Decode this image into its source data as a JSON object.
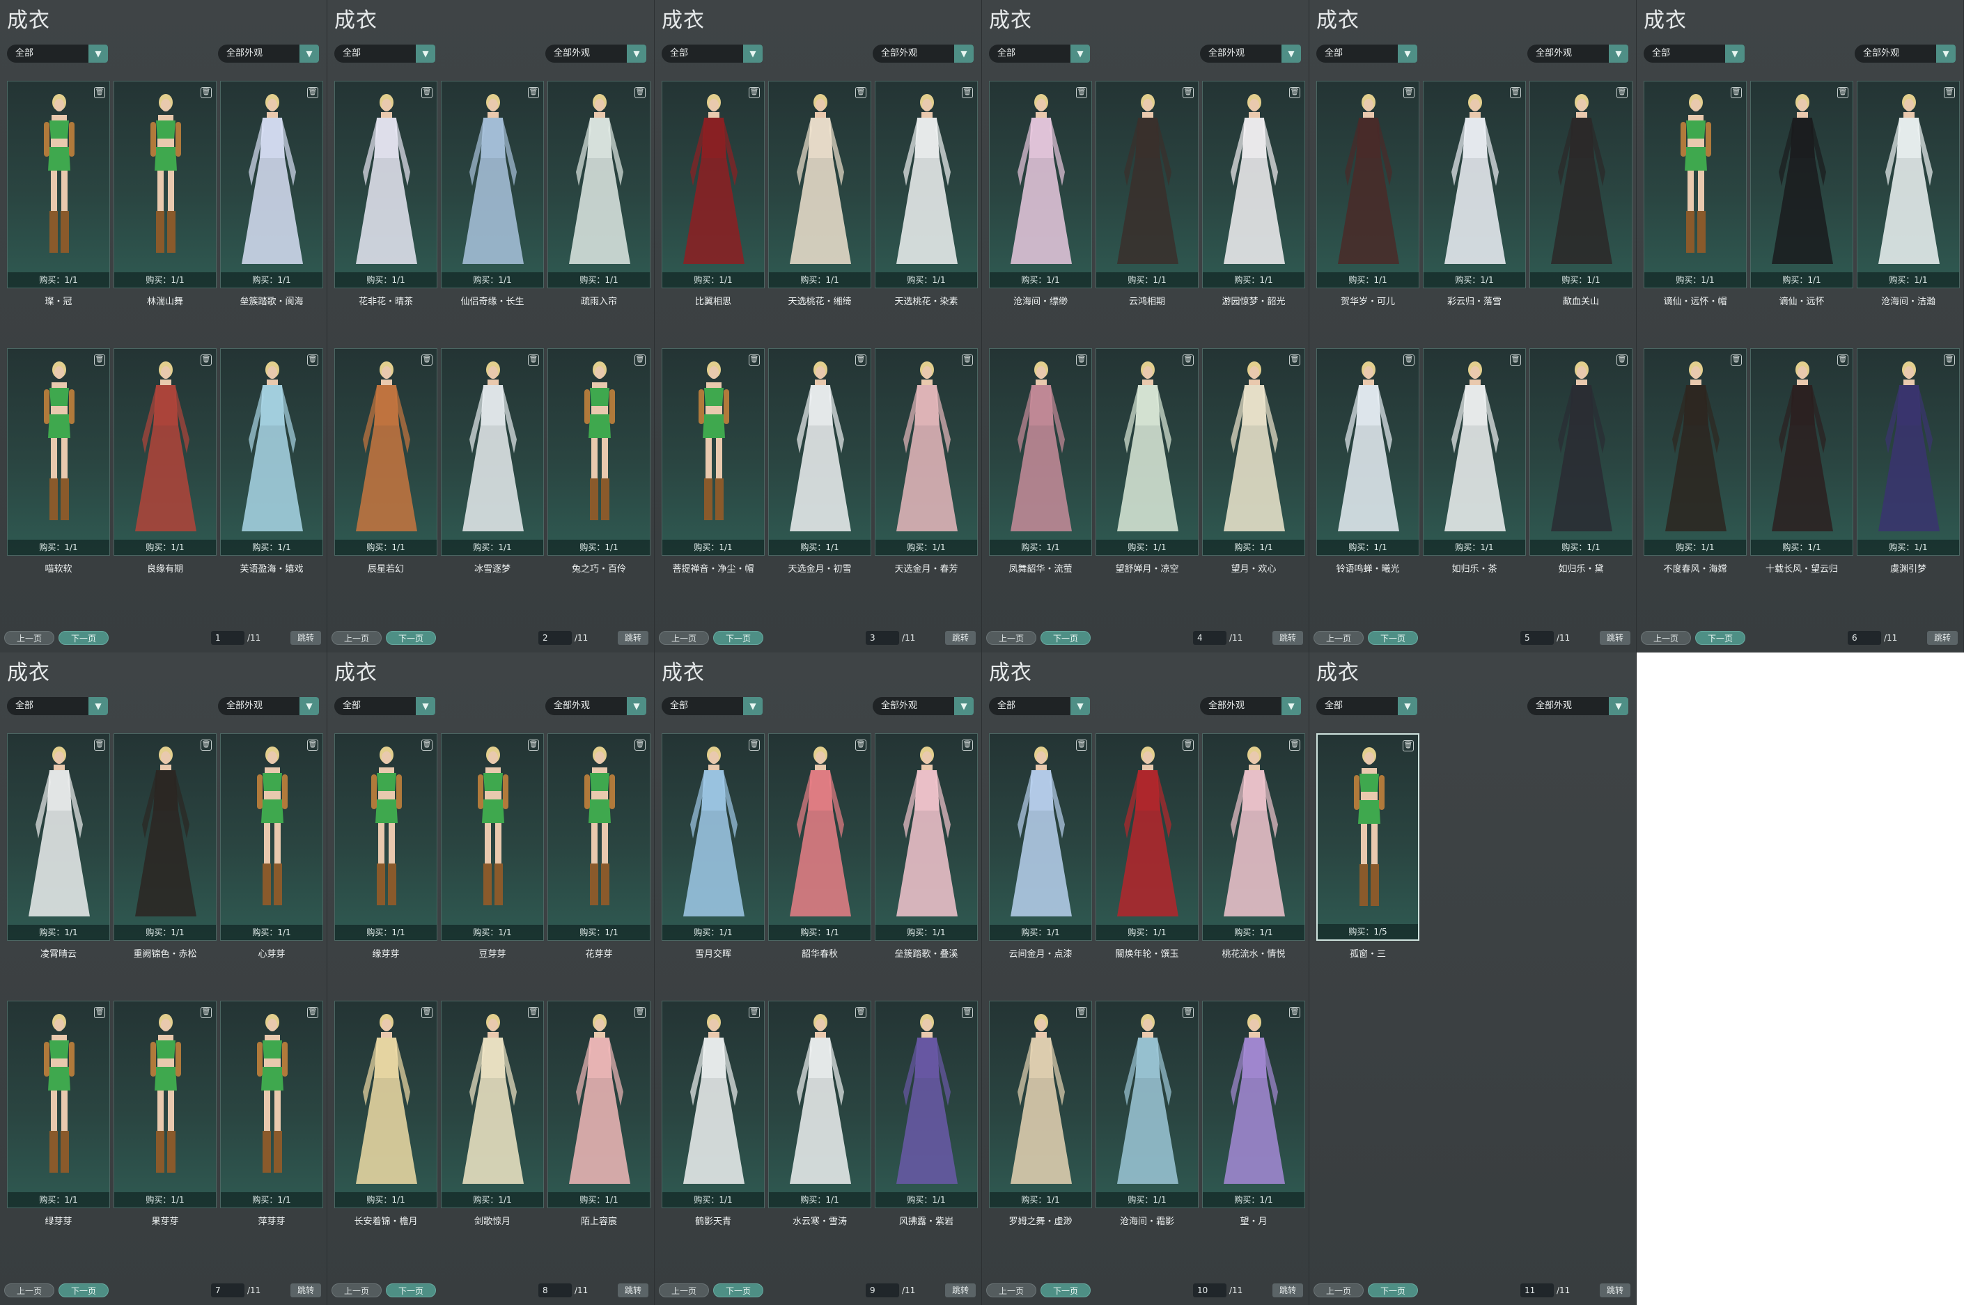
{
  "common": {
    "title": "成衣",
    "filter1": "全部",
    "filter2": "全部外观",
    "prev": "上一页",
    "next": "下一页",
    "total": "/11",
    "jump": "跳转"
  },
  "panels": [
    {
      "page": "1",
      "items": [
        {
          "buy": "购买：1/1",
          "name": "璨・冠"
        },
        {
          "buy": "购买：1/1",
          "name": "林湍山舞"
        },
        {
          "buy": "购买：1/1",
          "name": "垒簇踏歌・阆海"
        },
        {
          "buy": "购买：1/1",
          "name": "喵软软"
        },
        {
          "buy": "购买：1/1",
          "name": "良缘有期"
        },
        {
          "buy": "购买：1/1",
          "name": "芙语盈海・嬉戏"
        }
      ]
    },
    {
      "page": "2",
      "items": [
        {
          "buy": "购买：1/1",
          "name": "花非花・晴茶"
        },
        {
          "buy": "购买：1/1",
          "name": "仙侣奇缘・长生"
        },
        {
          "buy": "购买：1/1",
          "name": "疏雨入帘"
        },
        {
          "buy": "购买：1/1",
          "name": "辰星若幻"
        },
        {
          "buy": "购买：1/1",
          "name": "冰雪逐梦"
        },
        {
          "buy": "购买：1/1",
          "name": "兔之巧・百伶"
        }
      ]
    },
    {
      "page": "3",
      "items": [
        {
          "buy": "购买：1/1",
          "name": "比翼相思"
        },
        {
          "buy": "购买：1/1",
          "name": "天选桃花・缃绮"
        },
        {
          "buy": "购买：1/1",
          "name": "天选桃花・染素"
        },
        {
          "buy": "购买：1/1",
          "name": "菩提禅音・净尘・帽"
        },
        {
          "buy": "购买：1/1",
          "name": "天选金月・初雪"
        },
        {
          "buy": "购买：1/1",
          "name": "天选金月・春芳"
        }
      ]
    },
    {
      "page": "4",
      "items": [
        {
          "buy": "购买：1/1",
          "name": "沧海间・缥缈"
        },
        {
          "buy": "购买：1/1",
          "name": "云鸿相期"
        },
        {
          "buy": "购买：1/1",
          "name": "游园惊梦・韶光"
        },
        {
          "buy": "购买：1/1",
          "name": "凤舞韶华・流萤"
        },
        {
          "buy": "购买：1/1",
          "name": "望舒婵月・凉空"
        },
        {
          "buy": "购买：1/1",
          "name": "望月・欢心"
        }
      ]
    },
    {
      "page": "5",
      "items": [
        {
          "buy": "购买：1/1",
          "name": "贺华岁・可儿"
        },
        {
          "buy": "购买：1/1",
          "name": "彩云归・落雪"
        },
        {
          "buy": "购买：1/1",
          "name": "歃血关山"
        },
        {
          "buy": "购买：1/1",
          "name": "铃语鸣蝉・曦光"
        },
        {
          "buy": "购买：1/1",
          "name": "如归乐・茶"
        },
        {
          "buy": "购买：1/1",
          "name": "如归乐・黛"
        }
      ]
    },
    {
      "page": "6",
      "items": [
        {
          "buy": "购买：1/1",
          "name": "谪仙・远怀・帽"
        },
        {
          "buy": "购买：1/1",
          "name": "谪仙・远怀"
        },
        {
          "buy": "购买：1/1",
          "name": "沧海间・洁瀚"
        },
        {
          "buy": "购买：1/1",
          "name": "不度春风・海嫦"
        },
        {
          "buy": "购买：1/1",
          "name": "十载长风・望云归"
        },
        {
          "buy": "购买：1/1",
          "name": "虞渊引梦"
        }
      ]
    },
    {
      "page": "7",
      "items": [
        {
          "buy": "购买：1/1",
          "name": "凌霄晴云"
        },
        {
          "buy": "购买：1/1",
          "name": "重阙锦色・赤松"
        },
        {
          "buy": "购买：1/1",
          "name": "心芽芽"
        },
        {
          "buy": "购买：1/1",
          "name": "绿芽芽"
        },
        {
          "buy": "购买：1/1",
          "name": "果芽芽"
        },
        {
          "buy": "购买：1/1",
          "name": "萍芽芽"
        }
      ]
    },
    {
      "page": "8",
      "items": [
        {
          "buy": "购买：1/1",
          "name": "缘芽芽"
        },
        {
          "buy": "购买：1/1",
          "name": "豆芽芽"
        },
        {
          "buy": "购买：1/1",
          "name": "花芽芽"
        },
        {
          "buy": "购买：1/1",
          "name": "长安着锦・檐月"
        },
        {
          "buy": "购买：1/1",
          "name": "剑歌惊月"
        },
        {
          "buy": "购买：1/1",
          "name": "陌上容宸"
        }
      ]
    },
    {
      "page": "9",
      "items": [
        {
          "buy": "购买：1/1",
          "name": "雪月交晖"
        },
        {
          "buy": "购买：1/1",
          "name": "韶华春秋"
        },
        {
          "buy": "购买：1/1",
          "name": "垒簇踏歌・叠溪"
        },
        {
          "buy": "购买：1/1",
          "name": "鹤影天青"
        },
        {
          "buy": "购买：1/1",
          "name": "水云寒・雪涛"
        },
        {
          "buy": "购买：1/1",
          "name": "风拂露・紫岩"
        }
      ]
    },
    {
      "page": "10",
      "items": [
        {
          "buy": "购买：1/1",
          "name": "云间金月・点漆"
        },
        {
          "buy": "购买：1/1",
          "name": "關焕年轮・馔玉"
        },
        {
          "buy": "购买：1/1",
          "name": "桃花流水・情悦"
        },
        {
          "buy": "购买：1/1",
          "name": "罗姆之舞・虚渺"
        },
        {
          "buy": "购买：1/1",
          "name": "沧海间・霜影"
        },
        {
          "buy": "购买：1/1",
          "name": "望・月"
        }
      ]
    },
    {
      "page": "11",
      "items": [
        {
          "buy": "购买：1/5",
          "name": "孤窗・三"
        }
      ]
    }
  ],
  "colors": {
    "green-set": "#3fa84e",
    "skin": "#e9c9ae",
    "hair": "#e3cf8e",
    "boots": "#8a5a2b"
  }
}
